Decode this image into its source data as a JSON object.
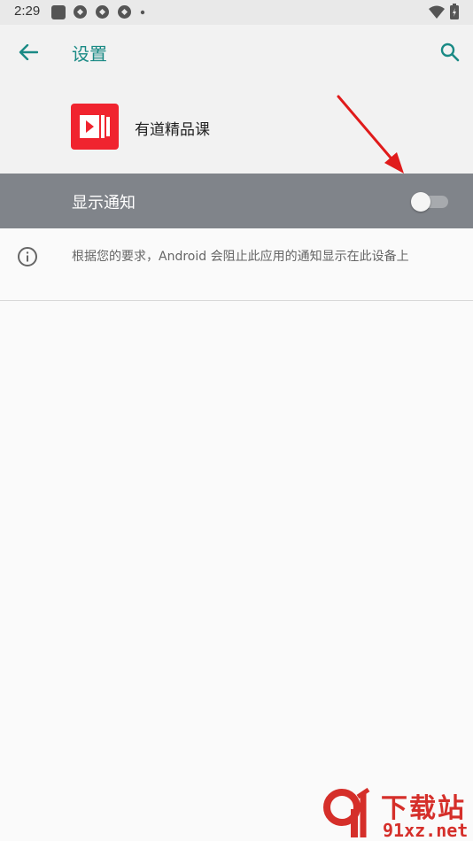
{
  "status_bar": {
    "time": "2:29",
    "left_icons": [
      "notification-square-icon",
      "sync-icon",
      "sync-icon",
      "sync-icon",
      "dot-icon"
    ],
    "right_icons": [
      "wifi-icon",
      "battery-icon"
    ]
  },
  "app_bar": {
    "back_icon": "back-arrow-icon",
    "title": "设置",
    "search_icon": "search-icon"
  },
  "app_header": {
    "app_name": "有道精品课",
    "icon_color": "#f0242f"
  },
  "notification_toggle": {
    "label": "显示通知",
    "enabled": false
  },
  "info": {
    "icon": "info-icon",
    "text": "根据您的要求，Android 会阻止此应用的通知显示在此设备上"
  },
  "watermark": {
    "title": "下载站",
    "domain": "91xz.net"
  },
  "colors": {
    "accent": "#1a8a85",
    "toggle_row_bg": "#80848a",
    "annotation_arrow": "#e01b1b",
    "watermark": "#d52f2a"
  }
}
